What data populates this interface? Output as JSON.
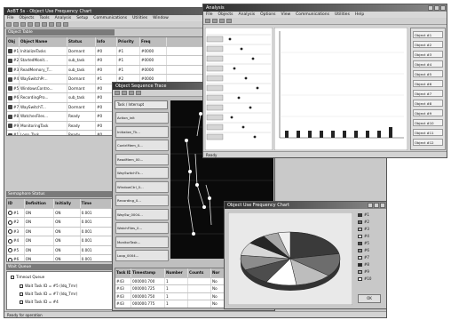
{
  "main": {
    "title": "AoBT 5s - Object Use Frequency Chart",
    "menu": [
      "File",
      "Objects",
      "Tools",
      "Analysis",
      "Setup",
      "Communications",
      "Utilities",
      "Window"
    ],
    "top_panel_title": "Object Table",
    "top_columns": [
      "Obj",
      "Object Name",
      "Status",
      "Info",
      "Priority",
      "Freq"
    ],
    "top_rows": [
      {
        "id": "#1",
        "name": "InitializeTasks",
        "status": "Dormant",
        "info": "#0",
        "pri": "#1",
        "freq": "#0000"
      },
      {
        "id": "#2",
        "name": "StartedMonit...",
        "status": "sub_task",
        "info": "#0",
        "pri": "#1",
        "freq": "#0000"
      },
      {
        "id": "#3",
        "name": "ReadMemory_T...",
        "status": "sub_task",
        "info": "#0",
        "pri": "#1",
        "freq": "#0000"
      },
      {
        "id": "#4",
        "name": "WaySwitchPr...",
        "status": "Dormant",
        "info": "#1",
        "pri": "#2",
        "freq": "#0000"
      },
      {
        "id": "#5",
        "name": "WindowsContro...",
        "status": "Dormant",
        "info": "#0",
        "pri": "#1",
        "freq": "#0000"
      },
      {
        "id": "#6",
        "name": "RecordingPro...",
        "status": "sub_task",
        "info": "#0",
        "pri": "#2",
        "freq": "#0000"
      },
      {
        "id": "#7",
        "name": "WaySwitchT...",
        "status": "Dormant",
        "info": "#0",
        "pri": "#1",
        "freq": "#0000"
      },
      {
        "id": "#8",
        "name": "WatchesFiles...",
        "status": "Ready",
        "info": "#0",
        "pri": "#1",
        "freq": "#0000"
      },
      {
        "id": "#9",
        "name": "MonitoringTask",
        "status": "Ready",
        "info": "#0",
        "pri": "#1",
        "freq": "#0000"
      },
      {
        "id": "#10",
        "name": "Loop_Task",
        "status": "Ready",
        "info": "#0",
        "pri": "#1",
        "freq": "#0000"
      }
    ],
    "mid_panel_title": "Semaphore Status",
    "mid_columns": [
      "ID",
      "Definition",
      "Initially",
      "Time"
    ],
    "mid_rows": [
      {
        "id": "#1",
        "def": "ON",
        "init": "ON",
        "time": "0.001"
      },
      {
        "id": "#2",
        "def": "ON",
        "init": "ON",
        "time": "0.001"
      },
      {
        "id": "#3",
        "def": "ON",
        "init": "ON",
        "time": "0.001"
      },
      {
        "id": "#4",
        "def": "ON",
        "init": "ON",
        "time": "0.001"
      },
      {
        "id": "#5",
        "def": "ON",
        "init": "ON",
        "time": "0.001"
      },
      {
        "id": "#6",
        "def": "ON",
        "init": "ON",
        "time": "0.001"
      }
    ],
    "bottom_panel_title": "Wait Queue",
    "tree_root": "Timeout Queue",
    "tree_items": [
      "Wait Task ID = #5 (ldq_Tmr)",
      "Wait Task ID = #7 (ldq_Tmr)",
      "Wait Task ID = #4"
    ],
    "status_text": "Ready for operation"
  },
  "trace": {
    "title": "Object Sequence Trace",
    "list_header": "Task / Interrupt",
    "list_items": [
      "Action_init",
      "Initialize_Tk...",
      "ContrlMem_0...",
      "ReadMem_00...",
      "WaySwitchTk...",
      "WindowCtrl_0...",
      "Recording_0...",
      "WaySw_0004...",
      "WatchFiles_0...",
      "MonitorTask...",
      "Loop_0004..."
    ],
    "table_columns": [
      "Task ID",
      "Timestamp",
      "Number",
      "Counts",
      "Nor"
    ],
    "table_rows": [
      [
        "#43",
        "000000.700",
        "1",
        "",
        "No"
      ],
      [
        "#43",
        "000000.725",
        "1",
        "",
        "No"
      ],
      [
        "#43",
        "000000.750",
        "1",
        "",
        "No"
      ],
      [
        "#43",
        "000000.775",
        "1",
        "",
        "No"
      ]
    ]
  },
  "freq": {
    "title": "Analysis",
    "menu": [
      "File",
      "Objects",
      "Analysis",
      "Options",
      "View",
      "Communications",
      "Utilities",
      "Help"
    ],
    "right_items": [
      "Object #1",
      "Object #2",
      "Object #3",
      "Object #4",
      "Object #5",
      "Object #6",
      "Object #7",
      "Object #8",
      "Object #9",
      "Object #10",
      "Object #11",
      "Object #12"
    ],
    "status_text": "Ready"
  },
  "pie": {
    "title": "Object Use Frequency Chart",
    "legend": [
      "#1",
      "#2",
      "#3",
      "#4",
      "#5",
      "#6",
      "#7",
      "#8",
      "#9",
      "#10"
    ],
    "legend_colors": [
      "#3a3a3a",
      "#6d6d6d",
      "#bdbdbd",
      "#ffffff",
      "#4d4d4d",
      "#8c8c8c",
      "#d7d7d7",
      "#262626",
      "#a8a8a8",
      "#f0f0f0"
    ],
    "ok_label": "OK"
  }
}
